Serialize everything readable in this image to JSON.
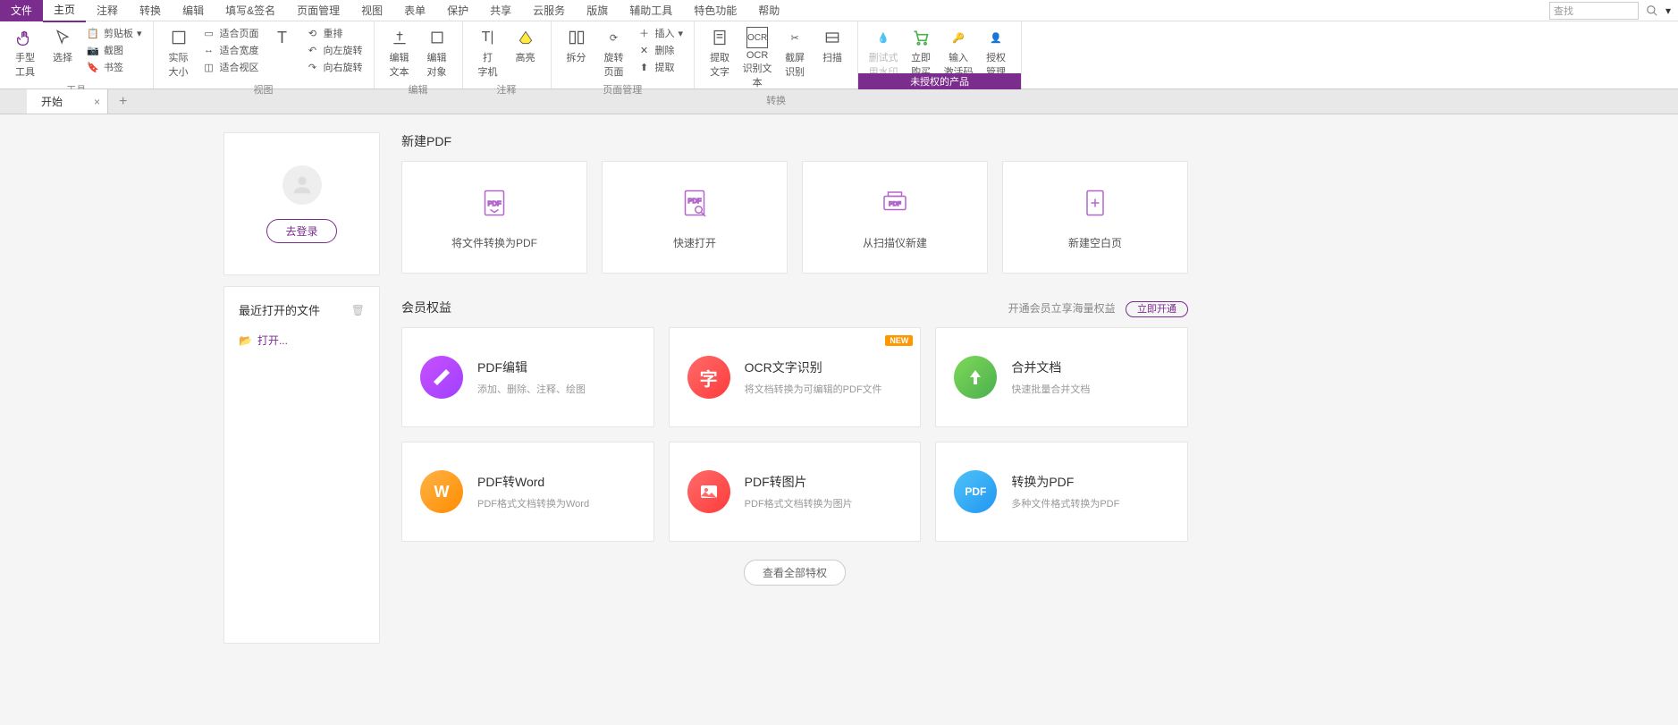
{
  "ribbon_tabs": {
    "file": "文件",
    "home": "主页",
    "annotate": "注释",
    "convert": "转换",
    "edit": "编辑",
    "fillsign": "填写&签名",
    "page": "页面管理",
    "view": "视图",
    "form": "表单",
    "protect": "保护",
    "share": "共享",
    "cloud": "云服务",
    "plugin": "版旗",
    "helper": "辅助工具",
    "special": "特色功能",
    "help": "帮助"
  },
  "search": {
    "placeholder": "查找"
  },
  "ribbon": {
    "hand_tool": "手型\n工具",
    "select": "选择",
    "clipboard": "剪贴板",
    "screenshot": "截图",
    "bookmark": "书签",
    "actual_size": "实际\n大小",
    "fit_page": "适合页面",
    "fit_width": "适合宽度",
    "fit_visible": "适合视区",
    "text_viewer": "T",
    "reflow": "重排",
    "rotate_left": "向左旋转",
    "rotate_right": "向右旋转",
    "edit_text": "编辑\n文本",
    "edit_object": "编辑\n对象",
    "typewriter": "打\n字机",
    "highlight": "高亮",
    "note": "注释",
    "split": "拆分",
    "rotate_page": "旋转\n页面",
    "insert": "插入",
    "delete_page": "删除",
    "extract_cmd": "提取",
    "extract": "提取\n文字",
    "ocr": "OCR\n识别文本",
    "screenshot_ocr": "截屏\n识别",
    "scan": "扫描",
    "watermark": "删试式\n用水印",
    "buy": "立即\n购买",
    "code": "输入\n激活码",
    "manage": "授权\n管理",
    "groups": {
      "tools": "工具",
      "view": "视图",
      "edit": "编辑",
      "annotate": "注释",
      "page": "页面管理",
      "convert": "转换",
      "license": "未授权的产品"
    }
  },
  "doc_tab": {
    "start": "开始"
  },
  "sidebar": {
    "login": "去登录",
    "recent_title": "最近打开的文件",
    "open": "打开..."
  },
  "new_pdf": {
    "title": "新建PDF",
    "convert": "将文件转换为PDF",
    "quick_open": "快速打开",
    "from_scanner": "从扫描仪新建",
    "blank": "新建空白页"
  },
  "member": {
    "title": "会员权益",
    "hint": "开通会员立享海量权益",
    "open_now": "立即开通",
    "features": [
      {
        "title": "PDF编辑",
        "desc": "添加、删除、注释、绘图"
      },
      {
        "title": "OCR文字识别",
        "desc": "将文档转换为可编辑的PDF文件",
        "badge": "NEW"
      },
      {
        "title": "合并文档",
        "desc": "快速批量合并文档"
      },
      {
        "title": "PDF转Word",
        "desc": "PDF格式文档转换为Word"
      },
      {
        "title": "PDF转图片",
        "desc": "PDF格式文档转换为图片"
      },
      {
        "title": "转换为PDF",
        "desc": "多种文件格式转换为PDF"
      }
    ],
    "view_all": "查看全部特权"
  }
}
